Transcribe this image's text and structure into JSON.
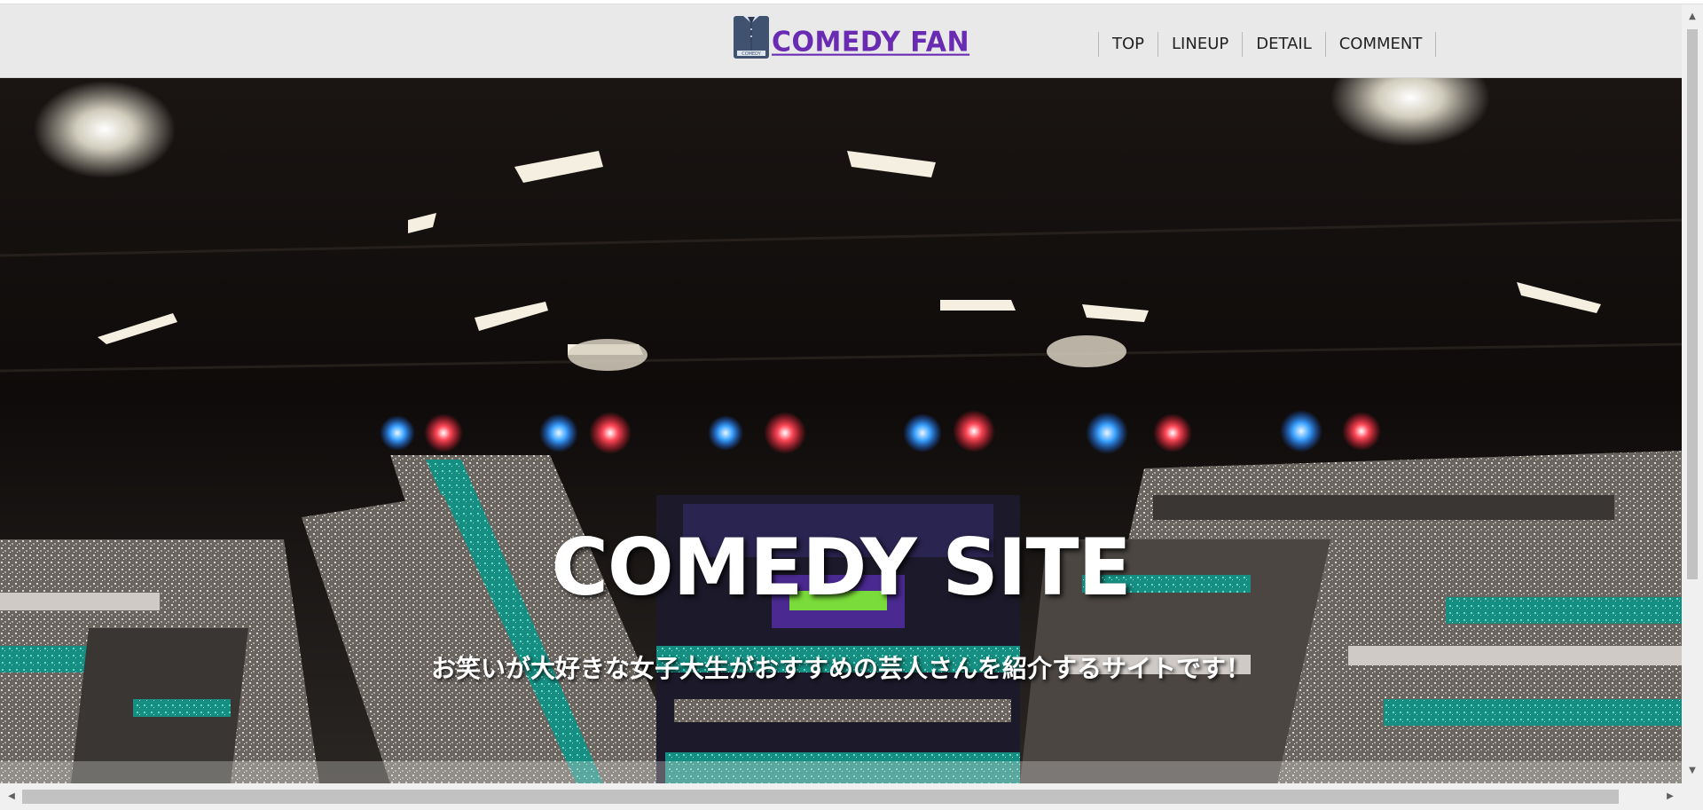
{
  "header": {
    "logo_text": "COMEDY FAN",
    "logo_icon": "shirt-icon",
    "logo_icon_label": "COMEDY",
    "nav": [
      {
        "label": "TOP"
      },
      {
        "label": "LINEUP"
      },
      {
        "label": "DETAIL"
      },
      {
        "label": "COMMENT"
      }
    ]
  },
  "hero": {
    "title": "COMEDY SITE",
    "subtitle": "お笑いが大好きな女子大生がおすすめの芸人さんを紹介するサイトです！"
  },
  "scrollbars": {
    "up_arrow": "▲",
    "down_arrow": "▼",
    "left_arrow": "◀",
    "right_arrow": "▶"
  },
  "colors": {
    "logo": "#6a2bb3",
    "header_bg": "#e9e9e9",
    "stage_teal": "#1fa89a",
    "stage_light_red": "#e8223a",
    "stage_light_blue": "#2a8fe0"
  }
}
